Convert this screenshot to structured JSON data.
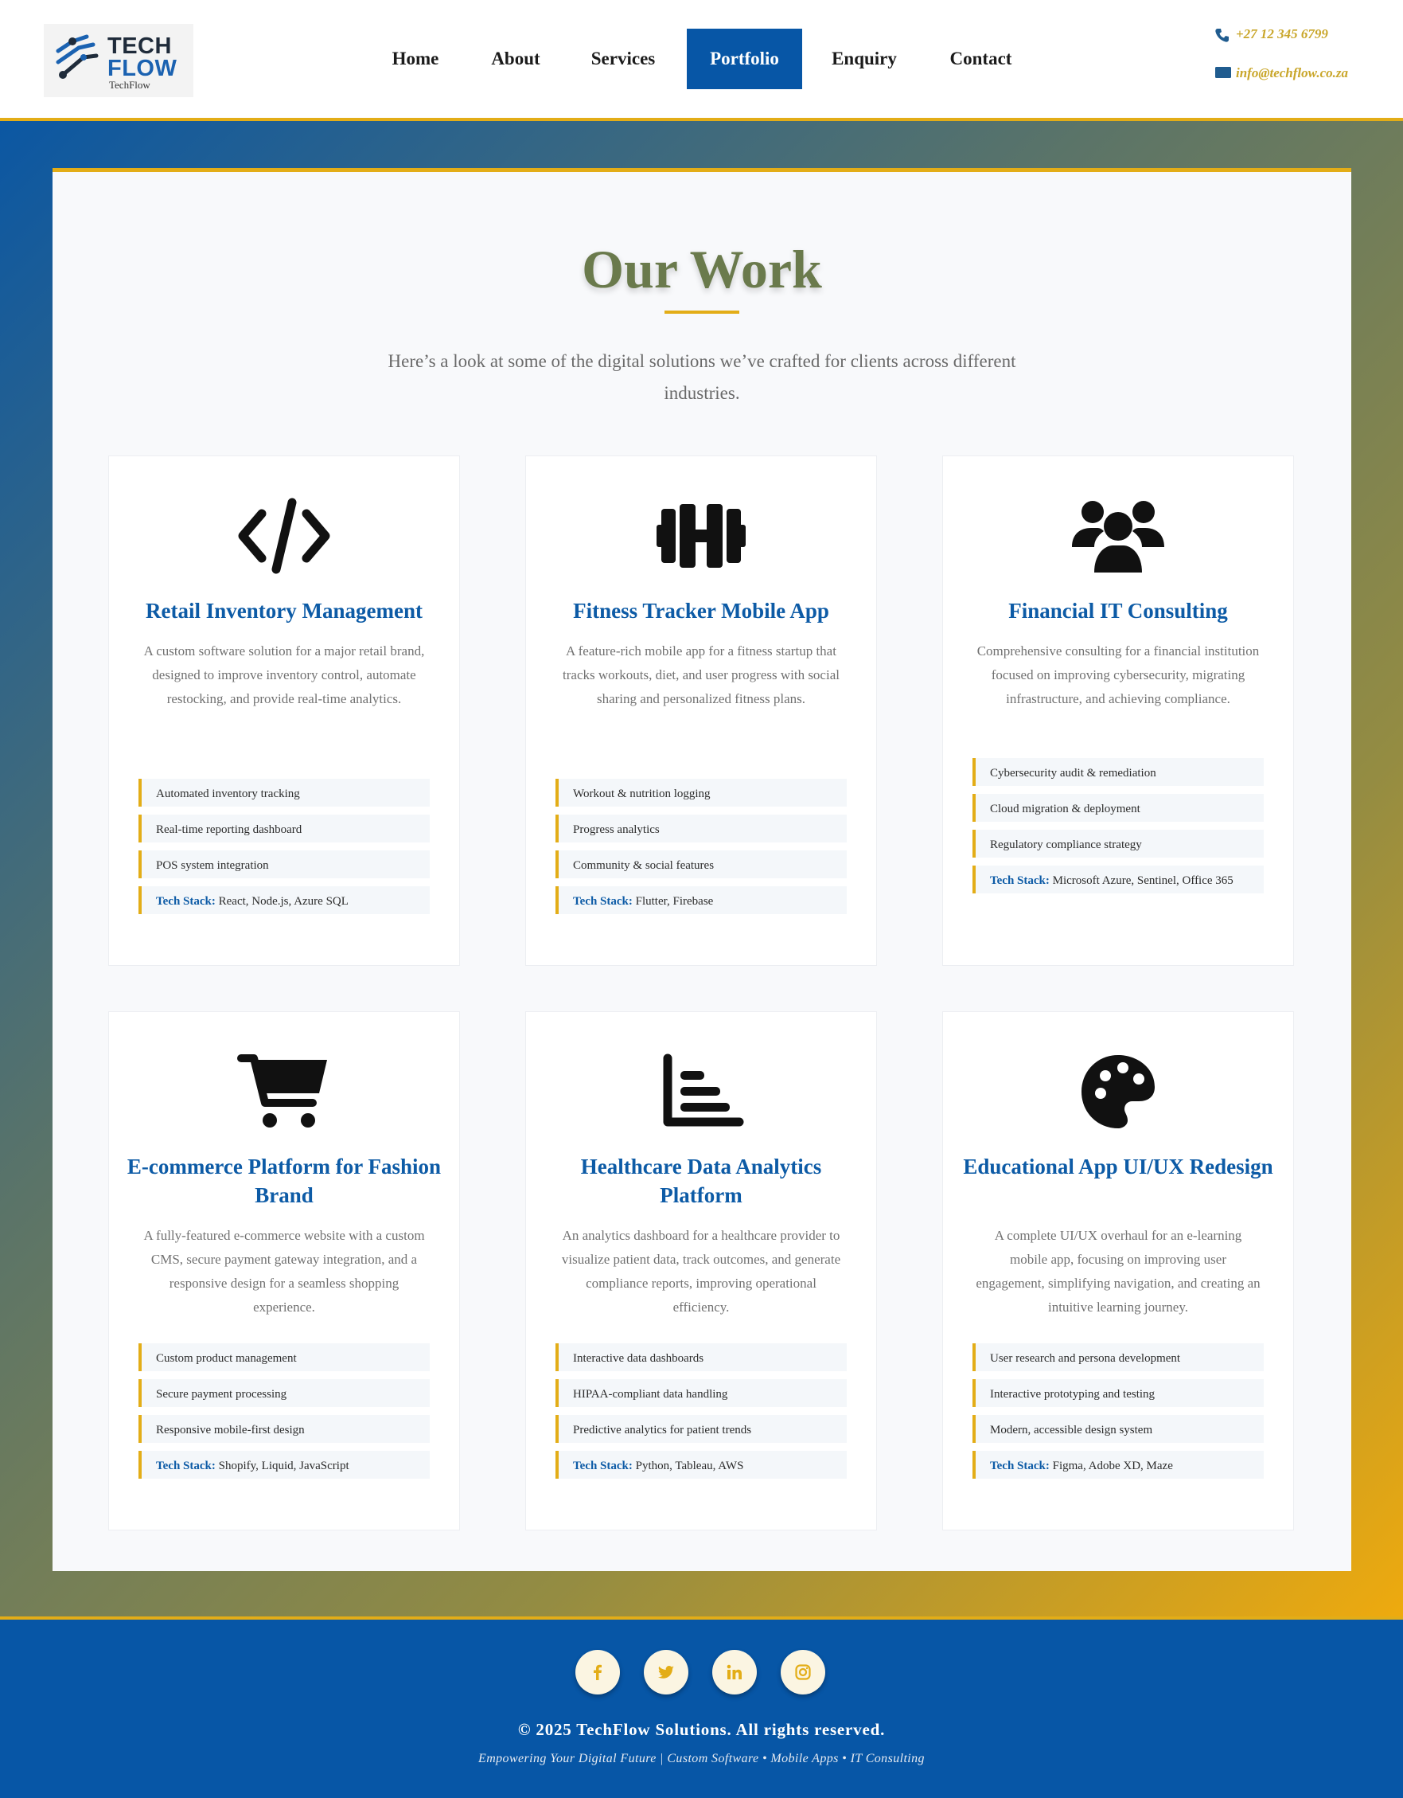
{
  "header": {
    "logo_main_top": "TECH",
    "logo_main_bottom": "FLOW",
    "logo_sub": "TechFlow",
    "nav": [
      {
        "label": "Home",
        "active": false
      },
      {
        "label": "About",
        "active": false
      },
      {
        "label": "Services",
        "active": false
      },
      {
        "label": "Portfolio",
        "active": true
      },
      {
        "label": "Enquiry",
        "active": false
      },
      {
        "label": "Contact",
        "active": false
      }
    ],
    "phone": "+27 12 345 6799",
    "email": "info@techflow.co.za",
    "phone_icon": "phone-icon",
    "email_icon": "envelope-icon"
  },
  "main": {
    "title": "Our Work",
    "intro": "Here’s a look at some of the digital solutions we’ve crafted for clients across different industries.",
    "cards": [
      {
        "icon": "code-icon",
        "title": "Retail Inventory Management",
        "desc": "A custom software solution for a major retail brand, designed to improve inventory control, automate restocking, and provide real-time analytics.",
        "features": [
          "Automated inventory tracking",
          "Real-time reporting dashboard",
          "POS system integration"
        ],
        "tech_label": "Tech Stack:",
        "tech": "React, Node.js, Azure SQL"
      },
      {
        "icon": "dumbbell-icon",
        "title": "Fitness Tracker Mobile App",
        "desc": "A feature-rich mobile app for a fitness startup that tracks workouts, diet, and user progress with social sharing and personalized fitness plans.",
        "features": [
          "Workout & nutrition logging",
          "Progress analytics",
          "Community & social features"
        ],
        "tech_label": "Tech Stack:",
        "tech": "Flutter, Firebase"
      },
      {
        "icon": "users-icon",
        "title": "Financial IT Consulting",
        "desc": "Comprehensive consulting for a financial institution focused on improving cybersecurity, migrating infrastructure, and achieving compliance.",
        "features": [
          "Cybersecurity audit & remediation",
          "Cloud migration & deployment",
          "Regulatory compliance strategy"
        ],
        "tech_label": "Tech Stack:",
        "tech": "Microsoft Azure, Sentinel, Office 365"
      },
      {
        "icon": "shopping-cart-icon",
        "title": "E-commerce Platform for Fashion Brand",
        "desc": "A fully-featured e-commerce website with a custom CMS, secure payment gateway integration, and a responsive design for a seamless shopping experience.",
        "features": [
          "Custom product management",
          "Secure payment processing",
          "Responsive mobile-first design"
        ],
        "tech_label": "Tech Stack:",
        "tech": "Shopify, Liquid, JavaScript"
      },
      {
        "icon": "bar-chart-icon",
        "title": "Healthcare Data Analytics Platform",
        "desc": "An analytics dashboard for a healthcare provider to visualize patient data, track outcomes, and generate compliance reports, improving operational efficiency.",
        "features": [
          "Interactive data dashboards",
          "HIPAA-compliant data handling",
          "Predictive analytics for patient trends"
        ],
        "tech_label": "Tech Stack:",
        "tech": "Python, Tableau, AWS"
      },
      {
        "icon": "palette-icon",
        "title": "Educational App UI/UX Redesign",
        "desc": "A complete UI/UX overhaul for an e-learning mobile app, focusing on improving user engagement, simplifying navigation, and creating an intuitive learning journey.",
        "features": [
          "User research and persona development",
          "Interactive prototyping and testing",
          "Modern, accessible design system"
        ],
        "tech_label": "Tech Stack:",
        "tech": "Figma, Adobe XD, Maze"
      }
    ]
  },
  "footer": {
    "social": [
      "facebook-icon",
      "twitter-icon",
      "linkedin-icon",
      "instagram-icon"
    ],
    "copyright": "© 2025 TechFlow Solutions. All rights reserved.",
    "tagline": "Empowering Your Digital Future | Custom Software • Mobile Apps • IT Consulting"
  },
  "colors": {
    "brand_blue": "#0756a6",
    "accent_gold": "#e3ad17",
    "title_olive": "#6a7a4c"
  }
}
